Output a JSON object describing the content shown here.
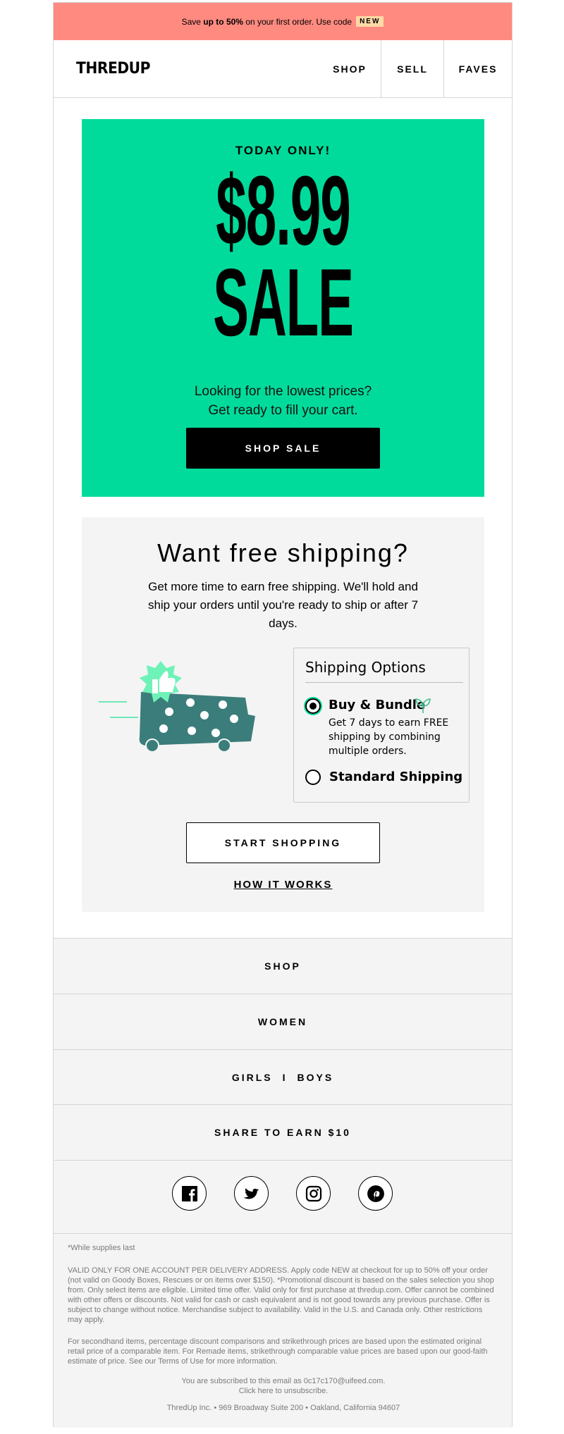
{
  "promo": {
    "prefix": "Save ",
    "bold": "up to 50%",
    "suffix": " on your first order. Use code",
    "code": "NEW"
  },
  "header": {
    "logo": "THREDUP",
    "nav": [
      "SHOP",
      "SELL",
      "FAVES"
    ]
  },
  "hero": {
    "kicker": "TODAY ONLY!",
    "price": "$8.99",
    "sale": "SALE",
    "copy_line1": "Looking for the lowest prices?",
    "copy_line2": "Get ready to fill your cart.",
    "cta": "SHOP SALE",
    "bg_color": "#00db9b"
  },
  "shipping": {
    "title": "Want free shipping?",
    "body": "Get more time to earn free shipping. We'll hold and ship your orders until you're ready to ship or after 7 days.",
    "options_title": "Shipping Options",
    "option1_label": "Buy & Bundle",
    "option1_desc": "Get 7 days to earn FREE shipping by combining multiple orders.",
    "option1_selected": true,
    "option2_label": "Standard Shipping",
    "option2_selected": false,
    "cta": "START SHOPPING",
    "link": "HOW IT WORKS"
  },
  "footer_nav": {
    "shop": "SHOP",
    "women": "WOMEN",
    "girls": "GIRLS",
    "divider": "I",
    "boys": "BOYS",
    "share": "SHARE TO EARN $10"
  },
  "social": [
    "facebook-icon",
    "twitter-icon",
    "instagram-icon",
    "pinterest-icon"
  ],
  "legal": {
    "supplies": "*While supplies last",
    "terms": "VALID ONLY FOR ONE ACCOUNT PER DELIVERY ADDRESS. Apply code NEW at checkout for up to 50% off your order (not valid on Goody Boxes, Rescues or on items over $150). *Promotional discount is based on the sales selection you shop from. Only select items are eligible. Limited time offer. Valid only for first purchase at thredup.com. Offer cannot be combined with other offers or discounts. Not valid for cash or cash equivalent and is not good towards any previous purchase. Offer is subject to change without notice. Merchandise subject to availability. Valid in the U.S. and Canada only. Other restrictions may apply.",
    "pricing": "For secondhand items, percentage discount comparisons and strikethrough prices are based upon the estimated original retail price of a comparable item. For Remade items, strikethrough comparable value prices are based upon our good-faith estimate of price. See our Terms of Use for more information.",
    "subscribed": "You are subscribed to this email as 0c17c170@uifeed.com.",
    "unsubscribe": "Click here to unsubscribe.",
    "address": "ThredUp Inc. • 969 Broadway Suite 200 • Oakland, California 94607"
  }
}
